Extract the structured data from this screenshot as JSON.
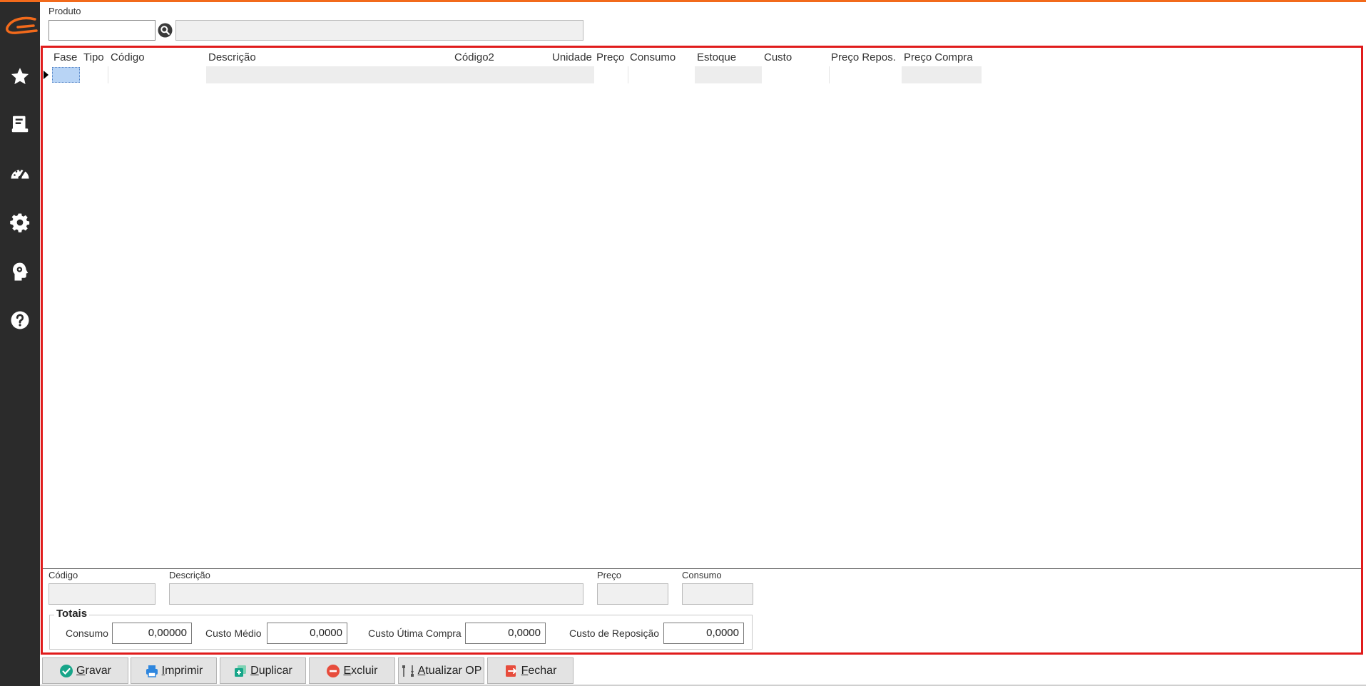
{
  "colors": {
    "accent": "#f26a1b",
    "frame": "#e01b1b",
    "sidebar": "#2b2b2b"
  },
  "sidebar": {
    "logo": "cg-logo-icon",
    "items": [
      {
        "icon": "star-icon"
      },
      {
        "icon": "report-icon"
      },
      {
        "icon": "dashboard-gauge-icon"
      },
      {
        "icon": "gear-icon"
      },
      {
        "icon": "head-gear-icon"
      },
      {
        "icon": "help-icon"
      }
    ]
  },
  "produto": {
    "label": "Produto",
    "code_value": "",
    "desc_value": ""
  },
  "grid": {
    "columns": [
      "Fase",
      "Tipo",
      "Código",
      "Descrição",
      "Código2",
      "Unidade",
      "Preço",
      "Consumo",
      "Estoque",
      "Custo",
      "Preço Repos.",
      "Preço Compra"
    ]
  },
  "detail": {
    "codigo_label": "Código",
    "descricao_label": "Descrição",
    "preco_label": "Preço",
    "consumo_label": "Consumo"
  },
  "totais": {
    "title": "Totais",
    "consumo_label": "Consumo",
    "consumo_value": "0,00000",
    "custo_medio_label": "Custo Médio",
    "custo_medio_value": "0,0000",
    "custo_ultima_label": "Custo Útima Compra",
    "custo_ultima_value": "0,0000",
    "custo_reposicao_label": "Custo de Reposição",
    "custo_reposicao_value": "0,0000"
  },
  "buttons": {
    "gravar": "Gravar",
    "imprimir": "Imprimir",
    "duplicar": "Duplicar",
    "excluir": "Excluir",
    "atualizar": "Atualizar OP",
    "fechar": "Fechar"
  }
}
